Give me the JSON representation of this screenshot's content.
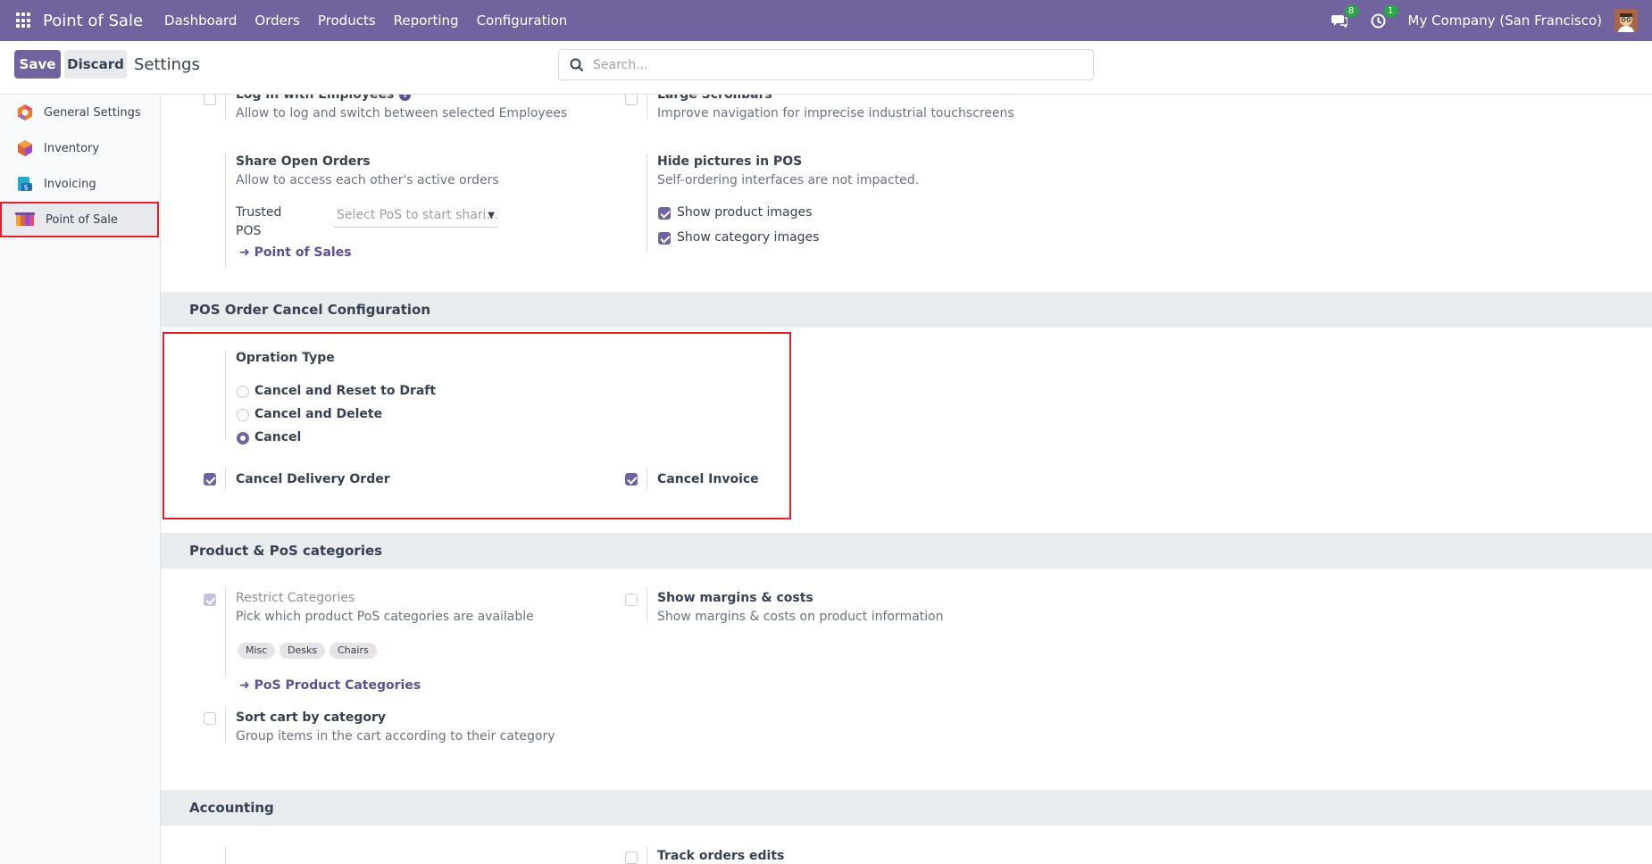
{
  "navbar": {
    "brand": "Point of Sale",
    "menu": [
      "Dashboard",
      "Orders",
      "Products",
      "Reporting",
      "Configuration"
    ],
    "messages_count": "8",
    "activities_count": "1",
    "company": "My Company (San Francisco)"
  },
  "control_panel": {
    "save_label": "Save",
    "discard_label": "Discard",
    "title": "Settings",
    "search_placeholder": "Search..."
  },
  "sidebar": {
    "items": [
      {
        "label": "General Settings"
      },
      {
        "label": "Inventory"
      },
      {
        "label": "Invoicing"
      },
      {
        "label": "Point of Sale"
      }
    ]
  },
  "settings_top": {
    "log_in_employees": {
      "title": "Log in with Employees",
      "desc": "Allow to log and switch between selected Employees",
      "checked": false
    },
    "large_scrollbars": {
      "title": "Large Scrollbars",
      "desc": "Improve navigation for imprecise industrial touchscreens",
      "checked": false
    },
    "share_open_orders": {
      "title": "Share Open Orders",
      "desc": "Allow to access each other's active orders",
      "trusted_label_1": "Trusted",
      "trusted_label_2": "POS",
      "trusted_placeholder": "Select PoS to start shari...",
      "link": "Point of Sales"
    },
    "hide_pictures": {
      "title": "Hide pictures in POS",
      "desc": "Self-ordering interfaces are not impacted.",
      "option_1": "Show product images",
      "option_2": "Show category images",
      "option_1_checked": true,
      "option_2_checked": true
    }
  },
  "cancel_section": {
    "heading": "POS Order Cancel Configuration",
    "operation_type_label": "Opration Type",
    "options": [
      "Cancel and Reset to Draft",
      "Cancel and Delete",
      "Cancel"
    ],
    "selected": "Cancel",
    "cancel_delivery_order": {
      "label": "Cancel Delivery Order",
      "checked": true
    },
    "cancel_invoice": {
      "label": "Cancel Invoice",
      "checked": true
    }
  },
  "categories_section": {
    "heading": "Product & PoS categories",
    "restrict_categories": {
      "title": "Restrict Categories",
      "desc": "Pick which product PoS categories are available",
      "checked": true,
      "tags": [
        "Misc",
        "Desks",
        "Chairs"
      ],
      "link": "PoS Product Categories"
    },
    "show_margins": {
      "title": "Show margins & costs",
      "desc": "Show margins & costs on product information",
      "checked": false
    },
    "sort_cart": {
      "title": "Sort cart by category",
      "desc": "Group items in the cart according to their category",
      "checked": false
    }
  },
  "accounting_section": {
    "heading": "Accounting",
    "track_orders_edits": {
      "title": "Track orders edits",
      "checked": false
    }
  },
  "colors": {
    "brand": "#71639e",
    "highlight": "#e0202a"
  }
}
